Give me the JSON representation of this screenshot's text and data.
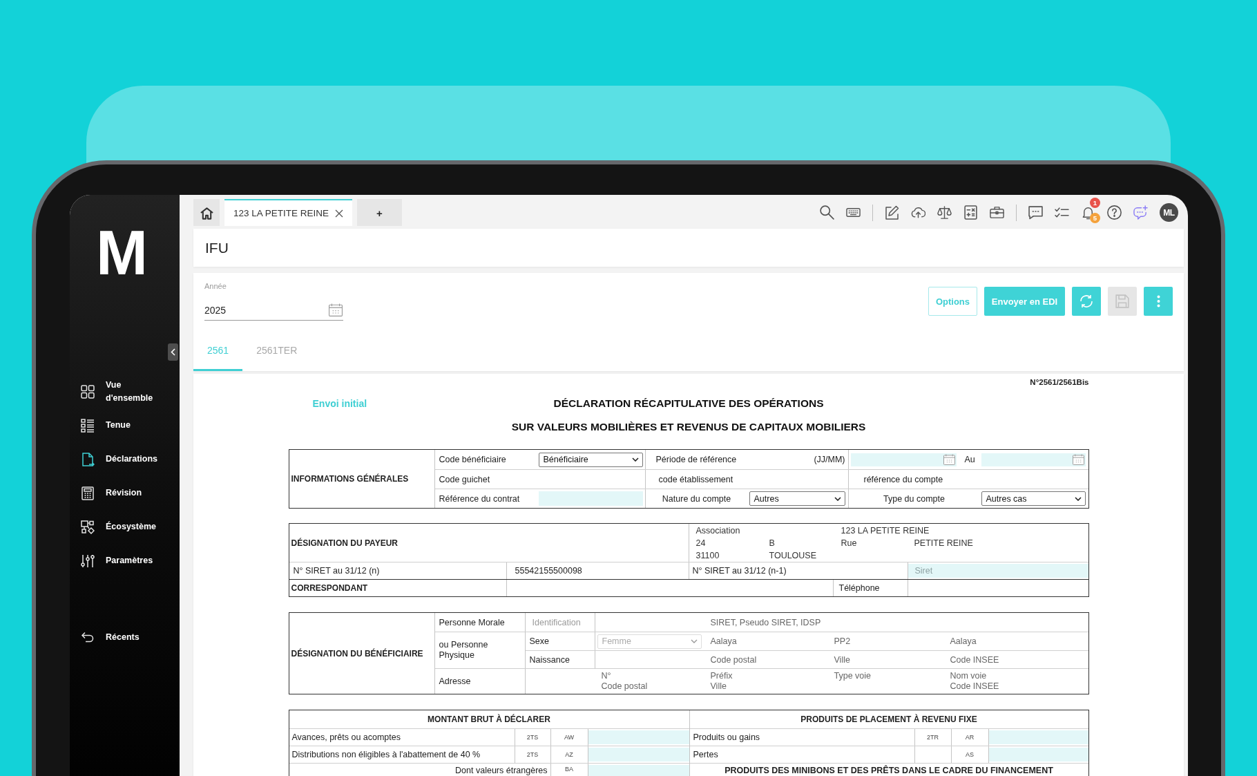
{
  "sidebar": {
    "logo": "M",
    "items": [
      {
        "kind": "overview",
        "label": "Vue d'ensemble",
        "selected": false
      },
      {
        "kind": "ledger",
        "label": "Tenue",
        "selected": false
      },
      {
        "kind": "declarations",
        "label": "Déclarations",
        "selected": true
      },
      {
        "kind": "review",
        "label": "Révision",
        "selected": false
      },
      {
        "kind": "ecosystem",
        "label": "Écosystème",
        "selected": false
      },
      {
        "kind": "settings",
        "label": "Paramètres",
        "selected": false
      }
    ],
    "recent": "Récents"
  },
  "tabs": [
    {
      "kind": "home",
      "selected": false
    },
    {
      "kind": "document",
      "label": "123 LA PETITE REINE",
      "selected": true
    },
    {
      "kind": "add",
      "label": "+",
      "selected": false
    }
  ],
  "toolbar": {
    "badges": [
      {
        "count": "1",
        "color": "#e8524a"
      },
      {
        "count": "5",
        "color": "#f4a23c"
      }
    ],
    "avatar": "ML"
  },
  "page": {
    "title": "IFU"
  },
  "year": {
    "label": "Année",
    "value": "2025"
  },
  "actions": [
    {
      "kind": "options",
      "label": "Options",
      "disabled": false
    },
    {
      "kind": "send",
      "label": "Envoyer en EDI",
      "disabled": false
    },
    {
      "kind": "refresh",
      "disabled": false
    },
    {
      "kind": "save",
      "disabled": true
    },
    {
      "kind": "more",
      "disabled": false
    }
  ],
  "form_tabs": [
    {
      "label": "2561",
      "selected": true
    },
    {
      "label": "2561TER",
      "selected": false
    }
  ],
  "form": {
    "reference": "N°2561/2561Bis",
    "status": "Envoi initial",
    "title": [
      "DÉCLARATION RÉCAPITULATIVE DES OPÉRATIONS",
      "SUR VALEURS MOBILIÈRES ET REVENUS DE CAPITAUX MOBILIERS"
    ],
    "general": {
      "heading": "INFORMATIONS GÉNÉRALES",
      "beneficiary_code": {
        "label": "Code bénéficiaire",
        "value": "Bénéficiaire"
      },
      "period": {
        "label": "Période de référence",
        "format": "(JJ/MM)",
        "to": "Au"
      },
      "branch_code": "Code guichet",
      "institution_code": "code établissement",
      "account_reference": "référence du compte",
      "contract_reference": "Référence du contrat",
      "account_nature": {
        "label": "Nature du compte",
        "value": "Autres"
      },
      "account_type": {
        "label": "Type du compte",
        "value": "Autres cas"
      }
    },
    "payer": {
      "heading": "DÉSIGNATION DU PAYEUR",
      "address": {
        "legal_form": "Association",
        "name": "123 LA PETITE REINE",
        "number": "24",
        "suffix": "B",
        "street_type": "Rue",
        "street": "PETITE REINE",
        "postal_code": "31100",
        "city": "TOULOUSE"
      },
      "siret": {
        "label": "N° SIRET au 31/12 (n)",
        "value": "55542155500098"
      },
      "siret_previous": {
        "label": "N° SIRET au 31/12 (n-1)",
        "placeholder": "Siret"
      },
      "correspondent": "CORRESPONDANT",
      "phone": "Téléphone"
    },
    "beneficiary": {
      "heading": "DÉSIGNATION DU BÉNÉFICIAIRE",
      "legal_person": {
        "label": "Personne Morale",
        "identification": "Identification",
        "id_types": "SIRET, Pseudo SIRET, IDSP"
      },
      "natural_person": {
        "label": "ou Personne Physique",
        "sex": {
          "label": "Sexe",
          "value": "Femme",
          "disabled": true
        },
        "names": [
          "Aalaya",
          "PP2",
          "Aalaya"
        ],
        "birth": {
          "label": "Naissance",
          "fields": [
            "Code postal",
            "Ville",
            "Code INSEE"
          ]
        }
      },
      "address": {
        "label": "Adresse",
        "columns": [
          [
            "N°",
            "Code postal"
          ],
          [
            "Préfix",
            "Ville"
          ],
          [
            "Type voie"
          ],
          [
            "Nom voie",
            "Code INSEE"
          ]
        ]
      }
    },
    "amounts": {
      "left": {
        "heading": "MONTANT BRUT À DÉCLARER",
        "rows": [
          {
            "kind": "line",
            "label": "Avances, prêts ou acomptes",
            "box": "2TS",
            "code": "AW"
          },
          {
            "kind": "line",
            "label": "Distributions non éligibles à l'abattement de 40 %",
            "box": "2TS",
            "code": "AZ"
          },
          {
            "kind": "subtotal",
            "label": "Dont valeurs étrangères",
            "code": "BA"
          }
        ]
      },
      "right": {
        "heading": "PRODUITS DE PLACEMENT À REVENU FIXE",
        "rows": [
          {
            "kind": "line",
            "label": "Produits ou gains",
            "box": "2TR",
            "code": "AR"
          },
          {
            "kind": "line",
            "label": "Pertes",
            "code": "AS"
          }
        ],
        "subheading": "PRODUITS DES MINIBONS ET DES PRÊTS DANS LE CADRE DU FINANCEMENT"
      }
    }
  }
}
